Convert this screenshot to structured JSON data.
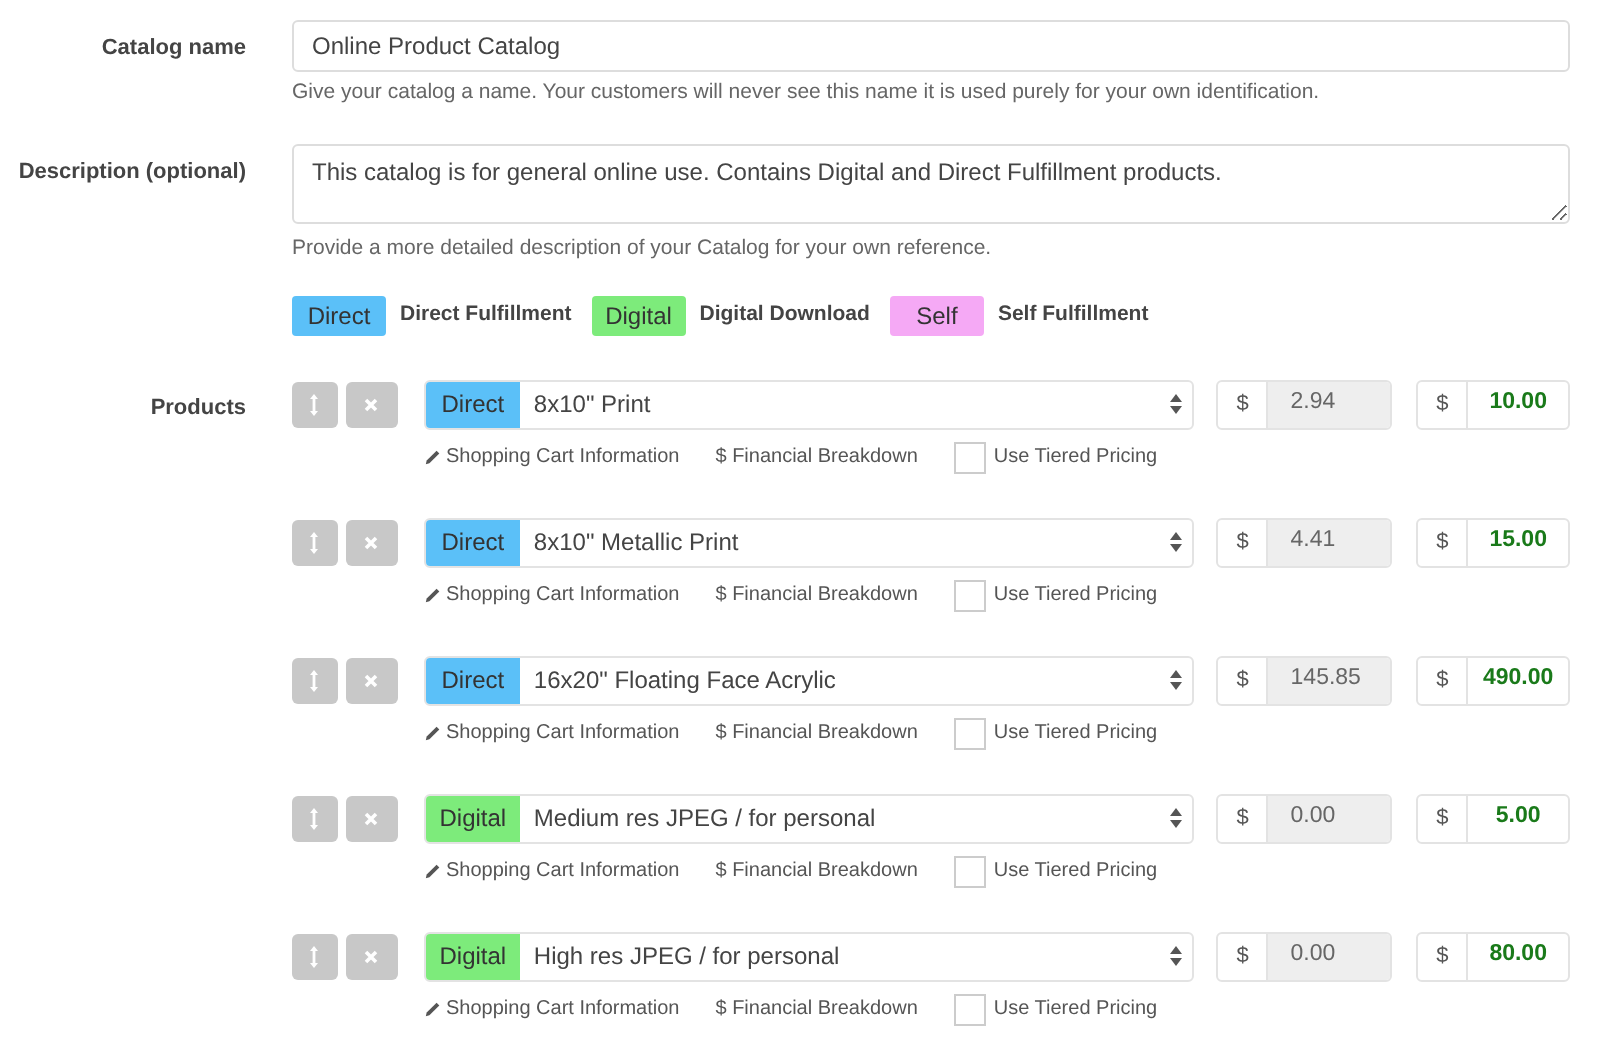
{
  "catalog_name": {
    "label": "Catalog name",
    "value": "Online Product Catalog",
    "help": "Give your catalog a name. Your customers will never see this name it is used purely for your own identification."
  },
  "description": {
    "label": "Description (optional)",
    "value": "This catalog is for general online use. Contains Digital and Direct Fulfillment products.",
    "help": "Provide a more detailed description of your Catalog for your own reference."
  },
  "legend": [
    {
      "tag": "Direct",
      "color": "#5bc0f8",
      "label": "Direct Fulfillment"
    },
    {
      "tag": "Digital",
      "color": "#7deb7b",
      "label": "Digital Download"
    },
    {
      "tag": "Self",
      "color": "#f5a9f5",
      "label": "Self Fulfillment"
    }
  ],
  "products": {
    "label": "Products",
    "rows": [
      {
        "tag": "Direct",
        "color": "#5bc0f8",
        "product": "8x10\" Print",
        "currency_1": "$",
        "cost": "2.94",
        "currency_2": "$",
        "price": "10.00",
        "links": [
          "Shopping Cart Information",
          "$ Financial Breakdown"
        ],
        "tiered_label": "Use Tiered Pricing",
        "tiered_checked": false
      },
      {
        "tag": "Direct",
        "color": "#5bc0f8",
        "product": "8x10\" Metallic Print",
        "currency_1": "$",
        "cost": "4.41",
        "currency_2": "$",
        "price": "15.00",
        "links": [
          "Shopping Cart Information",
          "$ Financial Breakdown"
        ],
        "tiered_label": "Use Tiered Pricing",
        "tiered_checked": false
      },
      {
        "tag": "Direct",
        "color": "#5bc0f8",
        "product": "16x20\" Floating Face Acrylic",
        "currency_1": "$",
        "cost": "145.85",
        "currency_2": "$",
        "price": "490.00",
        "links": [
          "Shopping Cart Information",
          "$ Financial Breakdown"
        ],
        "tiered_label": "Use Tiered Pricing",
        "tiered_checked": false
      },
      {
        "tag": "Digital",
        "color": "#7deb7b",
        "product": "Medium res JPEG / for personal",
        "currency_1": "$",
        "cost": "0.00",
        "currency_2": "$",
        "price": "5.00",
        "links": [
          "Shopping Cart Information",
          "$ Financial Breakdown"
        ],
        "tiered_label": "Use Tiered Pricing",
        "tiered_checked": false
      },
      {
        "tag": "Digital",
        "color": "#7deb7b",
        "product": "High res JPEG / for personal",
        "currency_1": "$",
        "cost": "0.00",
        "currency_2": "$",
        "price": "80.00",
        "links": [
          "Shopping Cart Information",
          "$ Financial Breakdown"
        ],
        "tiered_label": "Use Tiered Pricing",
        "tiered_checked": false
      }
    ]
  }
}
